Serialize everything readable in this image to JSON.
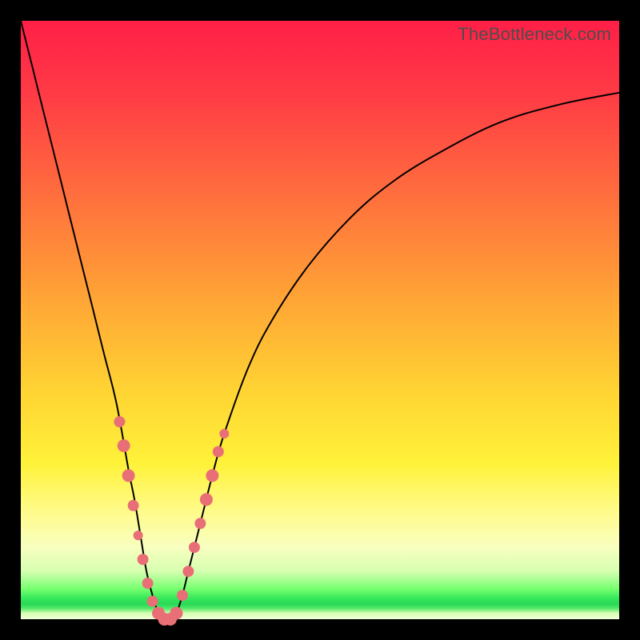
{
  "watermark": "TheBottleneck.com",
  "chart_data": {
    "type": "line",
    "title": "",
    "xlabel": "",
    "ylabel": "",
    "xlim": [
      0,
      100
    ],
    "ylim": [
      0,
      100
    ],
    "series": [
      {
        "name": "bottleneck-curve",
        "x": [
          0,
          2,
          4,
          6,
          8,
          10,
          12,
          14,
          16,
          18,
          19,
          20,
          21,
          22,
          23,
          24,
          25,
          26,
          27,
          28,
          30,
          32,
          34,
          38,
          42,
          48,
          55,
          62,
          70,
          80,
          90,
          100
        ],
        "y": [
          100,
          92,
          84,
          76,
          68,
          60,
          52,
          44,
          36,
          25,
          20,
          14,
          8,
          4,
          1,
          0,
          0,
          1,
          4,
          8,
          16,
          24,
          31,
          42,
          50,
          59,
          67,
          73,
          78,
          83,
          86,
          88
        ]
      }
    ],
    "markers": {
      "name": "highlighted-points",
      "points": [
        {
          "x": 16.5,
          "y": 33,
          "r": 7
        },
        {
          "x": 17.2,
          "y": 29,
          "r": 8
        },
        {
          "x": 18.0,
          "y": 24,
          "r": 8
        },
        {
          "x": 18.8,
          "y": 19,
          "r": 7
        },
        {
          "x": 19.6,
          "y": 14,
          "r": 6
        },
        {
          "x": 20.4,
          "y": 10,
          "r": 7
        },
        {
          "x": 21.2,
          "y": 6,
          "r": 7
        },
        {
          "x": 22.0,
          "y": 3,
          "r": 7
        },
        {
          "x": 23.0,
          "y": 1,
          "r": 8
        },
        {
          "x": 24.0,
          "y": 0,
          "r": 8
        },
        {
          "x": 25.0,
          "y": 0,
          "r": 8
        },
        {
          "x": 26.0,
          "y": 1,
          "r": 8
        },
        {
          "x": 27.0,
          "y": 4,
          "r": 7
        },
        {
          "x": 28.0,
          "y": 8,
          "r": 7
        },
        {
          "x": 29.0,
          "y": 12,
          "r": 7
        },
        {
          "x": 30.0,
          "y": 16,
          "r": 7
        },
        {
          "x": 31.0,
          "y": 20,
          "r": 8
        },
        {
          "x": 32.0,
          "y": 24,
          "r": 8
        },
        {
          "x": 33.0,
          "y": 28,
          "r": 7
        },
        {
          "x": 34.0,
          "y": 31,
          "r": 6
        }
      ]
    },
    "gradient_stops": [
      {
        "pct": 0,
        "color": "#ff1f47"
      },
      {
        "pct": 28,
        "color": "#ff6b3e"
      },
      {
        "pct": 62,
        "color": "#ffd433"
      },
      {
        "pct": 88,
        "color": "#f8ffc0"
      },
      {
        "pct": 96,
        "color": "#35e85a"
      },
      {
        "pct": 100,
        "color": "#f0ffd8"
      }
    ]
  }
}
